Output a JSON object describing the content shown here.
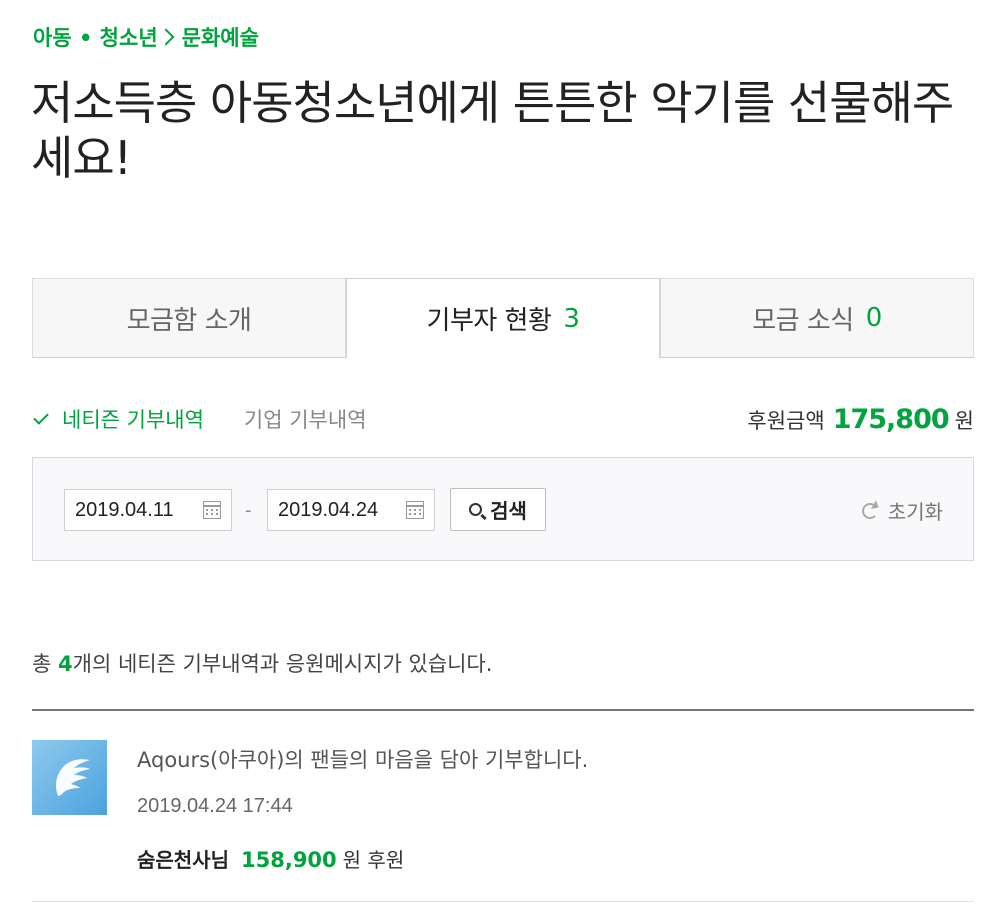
{
  "breadcrumb": {
    "category": "아동 • 청소년",
    "subcategory": "문화예술"
  },
  "title": "저소득층 아동청소년에게 튼튼한 악기를 선물해주세요!",
  "tabs": [
    {
      "label": "모금함 소개",
      "count": ""
    },
    {
      "label": "기부자 현황",
      "count": "3"
    },
    {
      "label": "모금 소식",
      "count": "0"
    }
  ],
  "filters": {
    "netizen": "네티즌 기부내역",
    "company": "기업 기부내역"
  },
  "total": {
    "label": "후원금액",
    "amount": "175,800",
    "unit": "원"
  },
  "search": {
    "start_date": "2019.04.11",
    "separator": "-",
    "end_date": "2019.04.24",
    "search_label": "검색",
    "reset_label": "초기화"
  },
  "summary": {
    "prefix": "총 ",
    "count": "4",
    "suffix": "개의 네티즌 기부내역과 응원메시지가 있습니다."
  },
  "donations": [
    {
      "message": "Aqours(아쿠아)의 팬들의 마음을 담아 기부합니다.",
      "datetime": "2019.04.24 17:44",
      "donor": "숨은천사님",
      "amount": "158,900",
      "suffix": "원 후원"
    }
  ],
  "colors": {
    "accent": "#00a33e",
    "avatar": "#5fb1e4"
  },
  "icons": {
    "breadcrumb_separator": "chevron-right-icon",
    "filter_check": "check-icon",
    "calendar": "calendar-icon",
    "search": "search-icon",
    "reset": "refresh-icon",
    "avatar": "angel-wing-icon"
  }
}
